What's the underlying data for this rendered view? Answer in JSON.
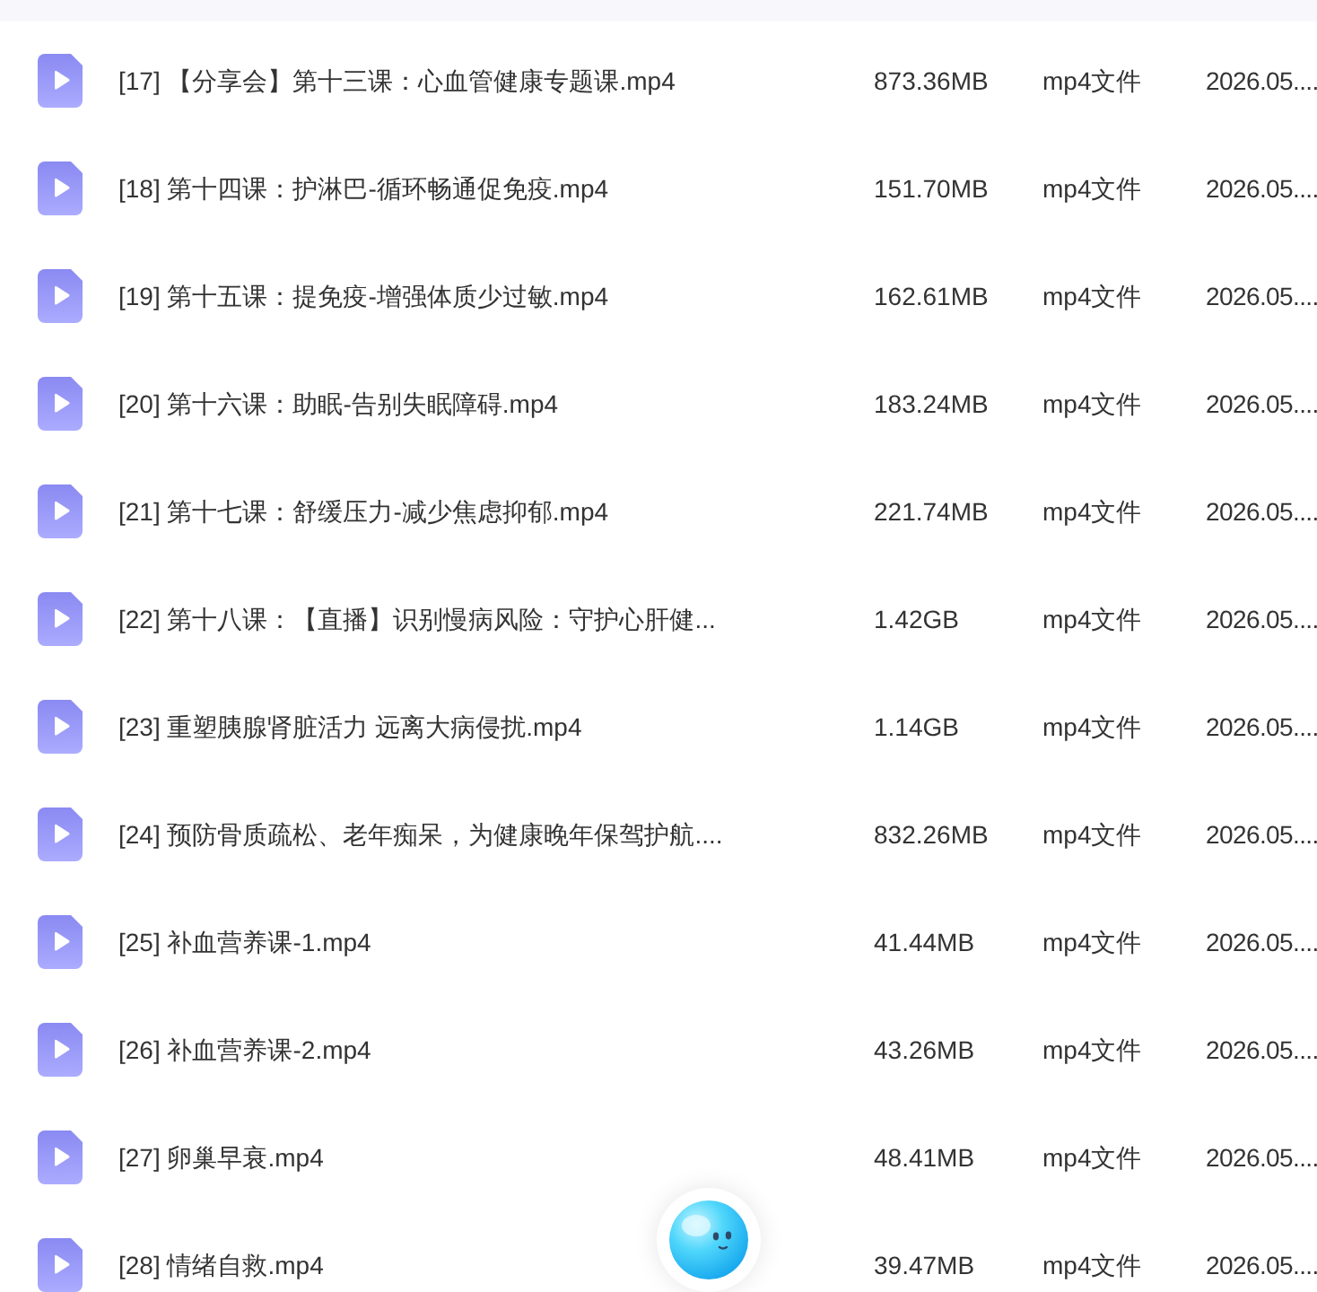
{
  "files": [
    {
      "name": "[17] 【分享会】第十三课：心血管健康专题课.mp4",
      "size": "873.36MB",
      "type": "mp4文件",
      "date": "2026.05...."
    },
    {
      "name": "[18] 第十四课：护淋巴-循环畅通促免疫.mp4",
      "size": "151.70MB",
      "type": "mp4文件",
      "date": "2026.05...."
    },
    {
      "name": "[19] 第十五课：提免疫-增强体质少过敏.mp4",
      "size": "162.61MB",
      "type": "mp4文件",
      "date": "2026.05...."
    },
    {
      "name": "[20] 第十六课：助眠-告别失眠障碍.mp4",
      "size": "183.24MB",
      "type": "mp4文件",
      "date": "2026.05...."
    },
    {
      "name": "[21] 第十七课：舒缓压力-减少焦虑抑郁.mp4",
      "size": "221.74MB",
      "type": "mp4文件",
      "date": "2026.05...."
    },
    {
      "name": "[22] 第十八课：【直播】识别慢病风险：守护心肝健...",
      "size": "1.42GB",
      "type": "mp4文件",
      "date": "2026.05...."
    },
    {
      "name": "[23] 重塑胰腺肾脏活力 远离大病侵扰.mp4",
      "size": "1.14GB",
      "type": "mp4文件",
      "date": "2026.05...."
    },
    {
      "name": "[24] 预防骨质疏松、老年痴呆，为健康晚年保驾护航....",
      "size": "832.26MB",
      "type": "mp4文件",
      "date": "2026.05...."
    },
    {
      "name": "[25] 补血营养课-1.mp4",
      "size": "41.44MB",
      "type": "mp4文件",
      "date": "2026.05...."
    },
    {
      "name": "[26] 补血营养课-2.mp4",
      "size": "43.26MB",
      "type": "mp4文件",
      "date": "2026.05...."
    },
    {
      "name": "[27] 卵巢早衰.mp4",
      "size": "48.41MB",
      "type": "mp4文件",
      "date": "2026.05...."
    },
    {
      "name": "[28] 情绪自救.mp4",
      "size": "39.47MB",
      "type": "mp4文件",
      "date": "2026.05...."
    }
  ]
}
